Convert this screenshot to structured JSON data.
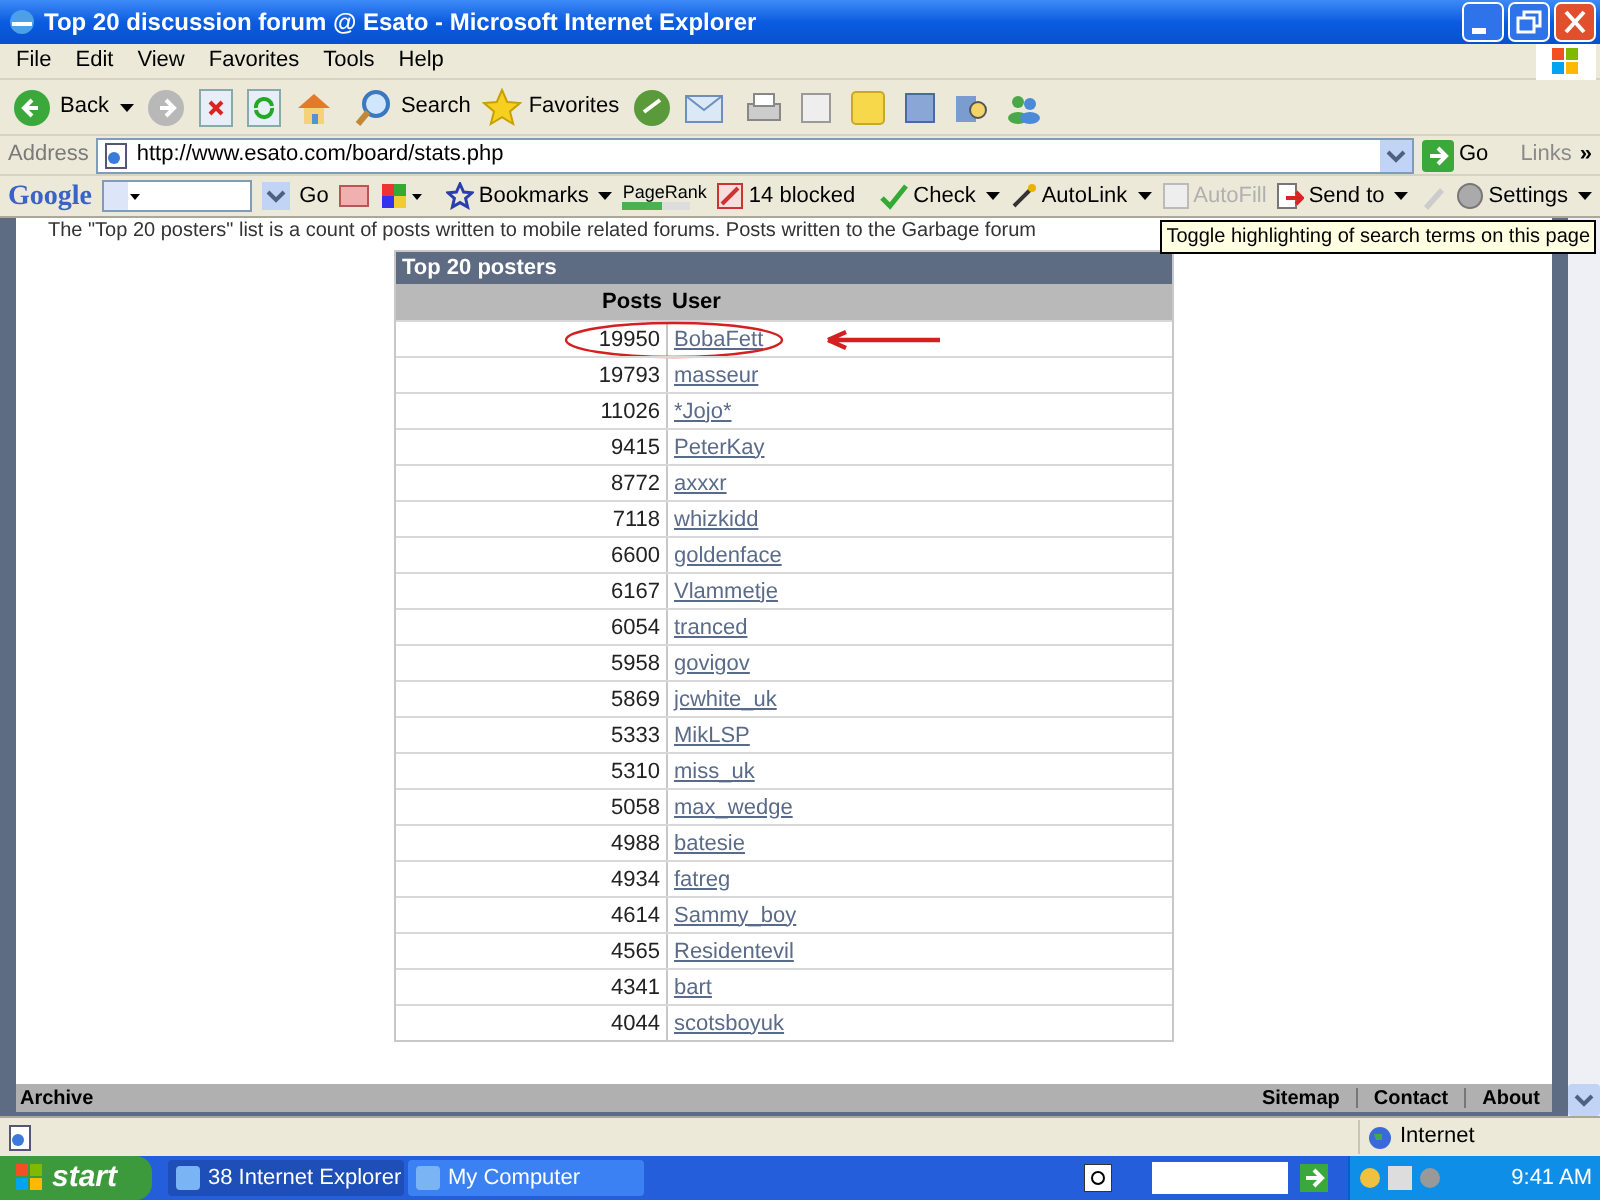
{
  "window": {
    "title": "Top 20 discussion forum @ Esato - Microsoft Internet Explorer"
  },
  "menu": [
    "File",
    "Edit",
    "View",
    "Favorites",
    "Tools",
    "Help"
  ],
  "toolbar": {
    "back": "Back",
    "search": "Search",
    "favorites": "Favorites"
  },
  "address": {
    "label": "Address",
    "url": "http://www.esato.com/board/stats.php",
    "go": "Go",
    "links": "Links",
    "more": "»"
  },
  "google_bar": {
    "logo": "Google",
    "go": "Go",
    "bookmarks": "Bookmarks",
    "pagerank": "PageRank",
    "blocked": "14 blocked",
    "check": "Check",
    "autolink": "AutoLink",
    "autofill": "AutoFill",
    "autofill_disabled": true,
    "send_to": "Send to",
    "settings": "Settings"
  },
  "tooltip": "Toggle highlighting of search terms on this page",
  "page": {
    "intro": "The \"Top 20 posters\" list is a count of posts written to mobile related forums. Posts written to the Garbage forum",
    "table": {
      "title": "Top 20 posters",
      "columns": [
        "Posts",
        "User"
      ],
      "rows": [
        {
          "posts": "19950",
          "user": "BobaFett",
          "circled": true
        },
        {
          "posts": "19793",
          "user": "masseur",
          "circled": false
        },
        {
          "posts": "11026",
          "user": "*Jojo*",
          "circled": false
        },
        {
          "posts": "9415",
          "user": "PeterKay",
          "circled": false
        },
        {
          "posts": "8772",
          "user": "axxxr",
          "circled": false
        },
        {
          "posts": "7118",
          "user": "whizkidd",
          "circled": false
        },
        {
          "posts": "6600",
          "user": "goldenface",
          "circled": false
        },
        {
          "posts": "6167",
          "user": "Vlammetje",
          "circled": false
        },
        {
          "posts": "6054",
          "user": "tranced",
          "circled": false
        },
        {
          "posts": "5958",
          "user": "govigov",
          "circled": false
        },
        {
          "posts": "5869",
          "user": "jcwhite_uk",
          "circled": false
        },
        {
          "posts": "5333",
          "user": "MikLSP",
          "circled": false
        },
        {
          "posts": "5310",
          "user": "miss_uk",
          "circled": false
        },
        {
          "posts": "5058",
          "user": "max_wedge",
          "circled": false
        },
        {
          "posts": "4988",
          "user": "batesie",
          "circled": false
        },
        {
          "posts": "4934",
          "user": "fatreg",
          "circled": false
        },
        {
          "posts": "4614",
          "user": "Sammy_boy",
          "circled": false
        },
        {
          "posts": "4565",
          "user": "Residentevil",
          "circled": false
        },
        {
          "posts": "4341",
          "user": "bart",
          "circled": false
        },
        {
          "posts": "4044",
          "user": "scotsboyuk",
          "circled": false
        }
      ]
    },
    "footer": {
      "left": "Archive",
      "links": [
        "Sitemap",
        "Contact",
        "About"
      ]
    }
  },
  "status_bar": {
    "zone": "Internet"
  },
  "taskbar": {
    "start": "start",
    "tasks": [
      {
        "label": "38 Internet Explorer",
        "selected": false
      },
      {
        "label": "My Computer",
        "selected": true
      }
    ],
    "clock": "9:41 AM"
  }
}
